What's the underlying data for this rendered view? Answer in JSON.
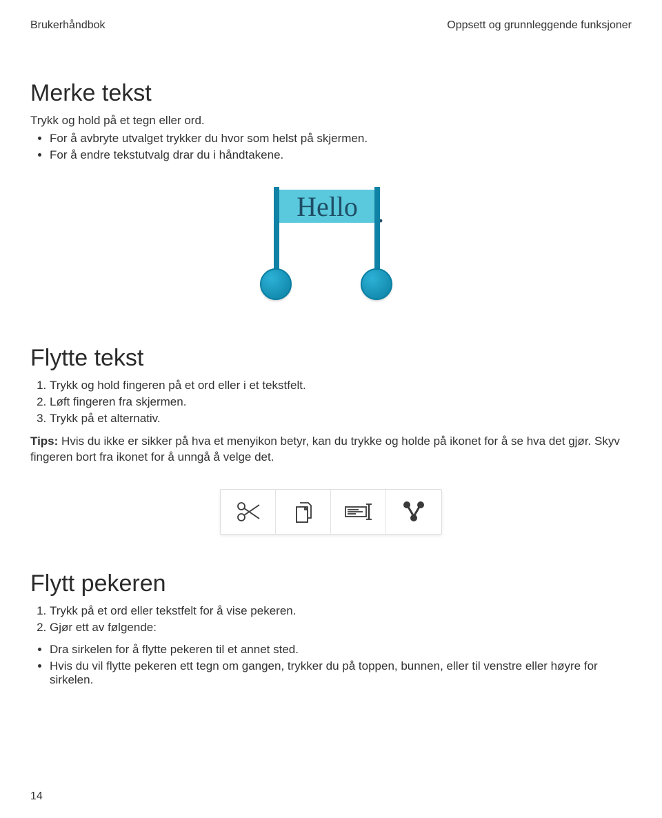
{
  "header": {
    "left": "Brukerhåndbok",
    "right": "Oppsett og grunnleggende funksjoner"
  },
  "section1": {
    "title": "Merke tekst",
    "intro": "Trykk og hold på et tegn eller ord.",
    "bullets": [
      "For å avbryte utvalget trykker du hvor som helst på skjermen.",
      "For å endre tekstutvalg drar du i håndtakene."
    ],
    "figure": {
      "word": "Hello",
      "trailing": "."
    }
  },
  "section2": {
    "title": "Flytte tekst",
    "steps": [
      "Trykk og hold fingeren på et ord eller i et tekstfelt.",
      "Løft fingeren fra skjermen.",
      "Trykk på et alternativ."
    ],
    "tips_label": "Tips:",
    "tips_text": " Hvis du ikke er sikker på hva et menyikon betyr, kan du trykke og holde på ikonet for å se hva det gjør. Skyv fingeren bort fra ikonet for å unngå å velge det.",
    "toolbar_icons": [
      "cut-icon",
      "copy-icon",
      "paste-icon",
      "share-icon"
    ]
  },
  "section3": {
    "title": "Flytt pekeren",
    "steps": [
      "Trykk på et ord eller tekstfelt for å vise pekeren.",
      "Gjør ett av følgende:"
    ],
    "bullets": [
      "Dra sirkelen for å flytte pekeren til et annet sted.",
      "Hvis du vil flytte pekeren ett tegn om gangen, trykker du på toppen, bunnen, eller til venstre eller høyre for sirkelen."
    ]
  },
  "page_number": "14"
}
